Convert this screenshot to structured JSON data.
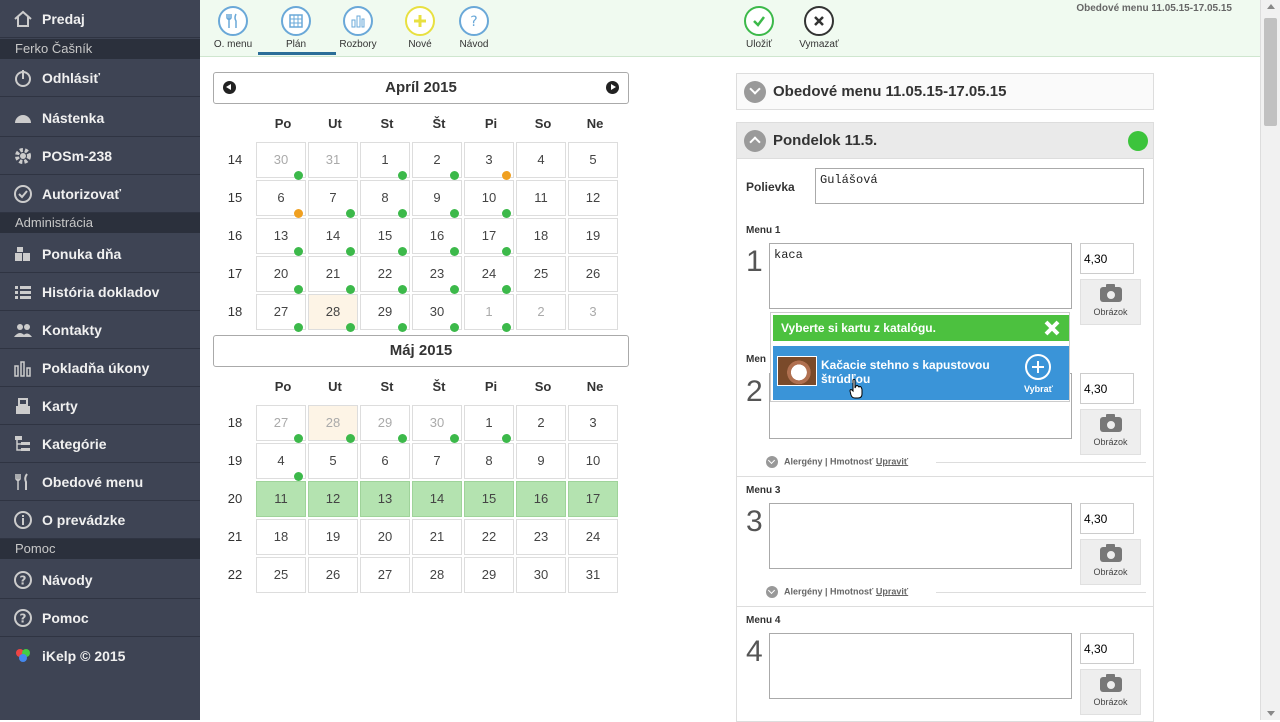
{
  "sidebar": {
    "items": [
      {
        "label": "Predaj",
        "icon": "home-icon"
      },
      {
        "label": "Odhlásiť",
        "icon": "power-icon"
      },
      {
        "label": "Nástenka",
        "icon": "dashboard-icon"
      },
      {
        "label": "POSm-238",
        "icon": "gear-icon"
      },
      {
        "label": "Autorizovať",
        "icon": "check-icon"
      },
      {
        "label": "Ponuka dňa",
        "icon": "daily-offer-icon"
      },
      {
        "label": "História dokladov",
        "icon": "list-icon"
      },
      {
        "label": "Kontakty",
        "icon": "contacts-icon"
      },
      {
        "label": "Pokladňa úkony",
        "icon": "bar-chart-icon"
      },
      {
        "label": "Karty",
        "icon": "cards-icon"
      },
      {
        "label": "Kategórie",
        "icon": "category-tree-icon"
      },
      {
        "label": "Obedové menu",
        "icon": "fork-knife-icon"
      },
      {
        "label": "O prevádzke",
        "icon": "info-icon"
      },
      {
        "label": "Návody",
        "icon": "question-icon"
      },
      {
        "label": "Pomoc",
        "icon": "help-icon"
      },
      {
        "label": "iKelp © 2015",
        "icon": "ikelp-logo-icon"
      }
    ],
    "sections": {
      "user": "Ferko Čašník",
      "admin": "Administrácia",
      "help": "Pomoc"
    }
  },
  "toolbar": {
    "omenu": "O. menu",
    "plan": "Plán",
    "rozbory": "Rozbory",
    "nove": "Nové",
    "navod": "Návod",
    "ulozit": "Uložiť",
    "vymazat": "Vymazať",
    "title": "Obedové menu 11.05.15-17.05.15"
  },
  "calendar": {
    "dow": [
      "Po",
      "Ut",
      "St",
      "Št",
      "Pi",
      "So",
      "Ne"
    ],
    "april": {
      "title": "Apríl 2015",
      "weeks": [
        "14",
        "15",
        "16",
        "17",
        "18"
      ],
      "days": [
        [
          {
            "d": "30",
            "o": 1,
            "dot": "g"
          },
          {
            "d": "31",
            "o": 1,
            "dot": ""
          },
          {
            "d": "1",
            "o": 0,
            "dot": "g"
          },
          {
            "d": "2",
            "o": 0,
            "dot": "g"
          },
          {
            "d": "3",
            "o": 0,
            "dot": "o"
          },
          {
            "d": "4",
            "o": 0,
            "dot": ""
          },
          {
            "d": "5",
            "o": 0,
            "dot": ""
          }
        ],
        [
          {
            "d": "6",
            "o": 0,
            "dot": "o"
          },
          {
            "d": "7",
            "o": 0,
            "dot": "g"
          },
          {
            "d": "8",
            "o": 0,
            "dot": "g"
          },
          {
            "d": "9",
            "o": 0,
            "dot": "g"
          },
          {
            "d": "10",
            "o": 0,
            "dot": "g"
          },
          {
            "d": "11",
            "o": 0,
            "dot": ""
          },
          {
            "d": "12",
            "o": 0,
            "dot": ""
          }
        ],
        [
          {
            "d": "13",
            "o": 0,
            "dot": "g"
          },
          {
            "d": "14",
            "o": 0,
            "dot": "g"
          },
          {
            "d": "15",
            "o": 0,
            "dot": "g"
          },
          {
            "d": "16",
            "o": 0,
            "dot": "g"
          },
          {
            "d": "17",
            "o": 0,
            "dot": "g"
          },
          {
            "d": "18",
            "o": 0,
            "dot": ""
          },
          {
            "d": "19",
            "o": 0,
            "dot": ""
          }
        ],
        [
          {
            "d": "20",
            "o": 0,
            "dot": "g"
          },
          {
            "d": "21",
            "o": 0,
            "dot": "g"
          },
          {
            "d": "22",
            "o": 0,
            "dot": "g"
          },
          {
            "d": "23",
            "o": 0,
            "dot": "g"
          },
          {
            "d": "24",
            "o": 0,
            "dot": "g"
          },
          {
            "d": "25",
            "o": 0,
            "dot": ""
          },
          {
            "d": "26",
            "o": 0,
            "dot": ""
          }
        ],
        [
          {
            "d": "27",
            "o": 0,
            "dot": "g"
          },
          {
            "d": "28",
            "o": 0,
            "dot": "g",
            "t": 1
          },
          {
            "d": "29",
            "o": 0,
            "dot": "g"
          },
          {
            "d": "30",
            "o": 0,
            "dot": "g"
          },
          {
            "d": "1",
            "o": 1,
            "dot": "g"
          },
          {
            "d": "2",
            "o": 1,
            "dot": ""
          },
          {
            "d": "3",
            "o": 1,
            "dot": ""
          }
        ]
      ]
    },
    "may": {
      "title": "Máj 2015",
      "weeks": [
        "18",
        "19",
        "20",
        "21",
        "22"
      ],
      "days": [
        [
          {
            "d": "27",
            "o": 1,
            "dot": "g"
          },
          {
            "d": "28",
            "o": 1,
            "dot": "g",
            "t": 1
          },
          {
            "d": "29",
            "o": 1,
            "dot": "g"
          },
          {
            "d": "30",
            "o": 1,
            "dot": "g"
          },
          {
            "d": "1",
            "o": 0,
            "dot": "g"
          },
          {
            "d": "2",
            "o": 0,
            "dot": ""
          },
          {
            "d": "3",
            "o": 0,
            "dot": ""
          }
        ],
        [
          {
            "d": "4",
            "o": 0,
            "dot": "g"
          },
          {
            "d": "5",
            "o": 0,
            "dot": ""
          },
          {
            "d": "6",
            "o": 0,
            "dot": ""
          },
          {
            "d": "7",
            "o": 0,
            "dot": ""
          },
          {
            "d": "8",
            "o": 0,
            "dot": ""
          },
          {
            "d": "9",
            "o": 0,
            "dot": ""
          },
          {
            "d": "10",
            "o": 0,
            "dot": ""
          }
        ],
        [
          {
            "d": "11",
            "o": 0,
            "dot": "",
            "s": 1
          },
          {
            "d": "12",
            "o": 0,
            "dot": "",
            "s": 1
          },
          {
            "d": "13",
            "o": 0,
            "dot": "",
            "s": 1
          },
          {
            "d": "14",
            "o": 0,
            "dot": "",
            "s": 1
          },
          {
            "d": "15",
            "o": 0,
            "dot": "",
            "s": 1
          },
          {
            "d": "16",
            "o": 0,
            "dot": "",
            "s": 1
          },
          {
            "d": "17",
            "o": 0,
            "dot": "",
            "s": 1
          }
        ],
        [
          {
            "d": "18",
            "o": 0,
            "dot": ""
          },
          {
            "d": "19",
            "o": 0,
            "dot": ""
          },
          {
            "d": "20",
            "o": 0,
            "dot": ""
          },
          {
            "d": "21",
            "o": 0,
            "dot": ""
          },
          {
            "d": "22",
            "o": 0,
            "dot": ""
          },
          {
            "d": "23",
            "o": 0,
            "dot": ""
          },
          {
            "d": "24",
            "o": 0,
            "dot": ""
          }
        ],
        [
          {
            "d": "25",
            "o": 0,
            "dot": ""
          },
          {
            "d": "26",
            "o": 0,
            "dot": ""
          },
          {
            "d": "27",
            "o": 0,
            "dot": ""
          },
          {
            "d": "28",
            "o": 0,
            "dot": ""
          },
          {
            "d": "29",
            "o": 0,
            "dot": ""
          },
          {
            "d": "30",
            "o": 0,
            "dot": ""
          },
          {
            "d": "31",
            "o": 0,
            "dot": ""
          }
        ]
      ]
    }
  },
  "menu": {
    "header": "Obedové menu 11.05.15-17.05.15",
    "day_title": "Pondelok 11.5.",
    "polievka_label": "Polievka",
    "polievka_value": "Gulášová",
    "items": [
      {
        "label": "Menu 1",
        "num": "1",
        "value": "kaca",
        "price": "4,30"
      },
      {
        "label": "Menu 2",
        "num": "2",
        "value": "",
        "price": "4,30"
      },
      {
        "label": "Menu 3",
        "num": "3",
        "value": "",
        "price": "4,30"
      },
      {
        "label": "Menu 4",
        "num": "4",
        "value": "",
        "price": "4,30"
      }
    ],
    "image_label": "Obrázok",
    "allergen_text": "Alergény | Hmotnosť",
    "edit_link": "Upraviť",
    "menu2_partial": "Men"
  },
  "popup": {
    "header": "Vyberte si kartu z katalógu.",
    "item": "Kačacie stehno s kapustovou štrúdľou",
    "select": "Vybrať"
  },
  "colors": {
    "sidebar": "#3e4454",
    "green": "#4cc13f",
    "blue": "#3a94d8",
    "selected_week": "#b4e3b0"
  }
}
